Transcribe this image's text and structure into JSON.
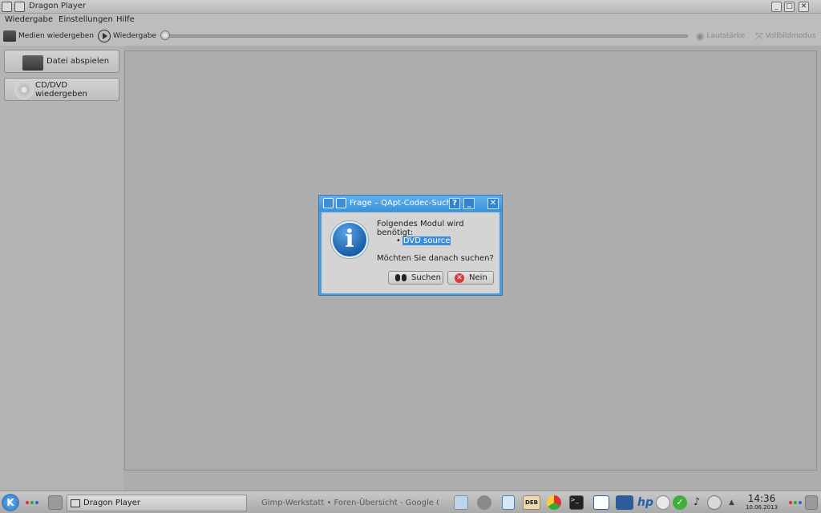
{
  "window": {
    "title": "Dragon Player"
  },
  "menubar": {
    "items": [
      "Wiedergabe",
      "Einstellungen",
      "Hilfe"
    ]
  },
  "toolbar": {
    "media_label": "Medien wiedergeben",
    "play_label": "Wiedergabe",
    "volume_label": "Lautstärke",
    "fullscreen_label": "Vollbildmodus",
    "position_progress": 0.0
  },
  "left_panel": {
    "play_file_label": "Datei abspielen",
    "play_disc_label": "CD/DVD wiedergeben"
  },
  "dialog": {
    "title": "Frage – QApt-Codec-Suche",
    "help_button": "?",
    "message_line1": "Folgendes Modul wird benötigt:",
    "module": "DVD source",
    "message_line2": "Möchten Sie danach suchen?",
    "search_button": "Suchen",
    "no_button": "Nein"
  },
  "taskbar": {
    "tasks": [
      "Dragon Player",
      "Gimp-Werkstatt • Foren-Übersicht - Google Chr"
    ],
    "deb_label": "DEB",
    "time": "14:36",
    "date": "10.06.2013"
  },
  "colors": {
    "accent": "#4a9ee0",
    "selection": "#3f8edb",
    "background": "#adadad"
  },
  "icons": [
    "kde-menu-icon",
    "play-icon",
    "volume-icon",
    "fullscreen-icon",
    "folder-icon",
    "disc-icon",
    "info-icon",
    "binoculars-icon",
    "cancel-icon"
  ]
}
